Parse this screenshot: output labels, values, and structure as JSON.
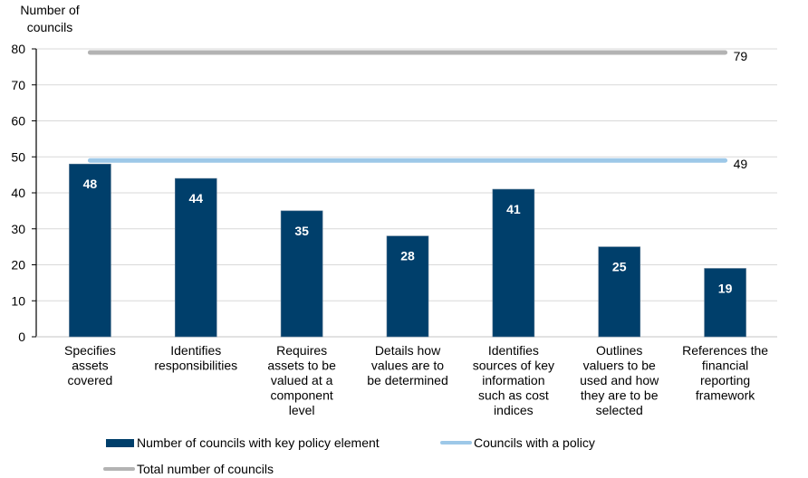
{
  "chart_data": {
    "type": "bar",
    "title": "",
    "ylabel": "Number of councils",
    "xlabel": "",
    "ylim": [
      0,
      80
    ],
    "yticks": [
      0,
      10,
      20,
      30,
      40,
      50,
      60,
      70,
      80
    ],
    "grid": true,
    "categories": [
      "Specifies assets covered",
      "Identifies responsibilities",
      "Requires assets to be valued at a component level",
      "Details how values are to be determined",
      "Identifies sources of key information such as cost indices",
      "Outlines valuers to be used and how they are to be selected",
      "References the financial reporting framework"
    ],
    "category_lines": [
      [
        "Specifies",
        "assets",
        "covered"
      ],
      [
        "Identifies",
        "responsibilities"
      ],
      [
        "Requires",
        "assets to be",
        "valued at a",
        "component",
        "level"
      ],
      [
        "Details how",
        "values are to",
        "be determined"
      ],
      [
        "Identifies",
        "sources of key",
        "information",
        "such as cost",
        "indices"
      ],
      [
        "Outlines",
        "valuers to be",
        "used and how",
        "they are to be",
        "selected"
      ],
      [
        "References the",
        "financial",
        "reporting",
        "framework"
      ]
    ],
    "series": [
      {
        "name": "Number of councils with key policy element",
        "type": "bar",
        "color": "#003f6b",
        "values": [
          48,
          44,
          35,
          28,
          41,
          25,
          19
        ]
      },
      {
        "name": "Councils with a policy",
        "type": "line",
        "color": "#9dc8e8",
        "values": [
          49,
          49,
          49,
          49,
          49,
          49,
          49
        ],
        "end_label": "49"
      },
      {
        "name": "Total number of councils",
        "type": "line",
        "color": "#b3b3b3",
        "values": [
          79,
          79,
          79,
          79,
          79,
          79,
          79
        ],
        "end_label": "79"
      }
    ],
    "legend_position": "bottom"
  }
}
